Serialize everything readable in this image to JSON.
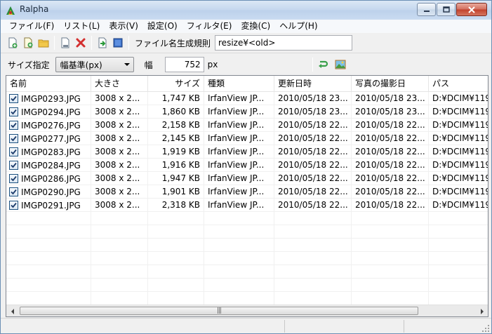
{
  "window": {
    "title": "Ralpha"
  },
  "menu": [
    "ファイル(F)",
    "リスト(L)",
    "表示(V)",
    "設定(O)",
    "フィルタ(E)",
    "変換(C)",
    "ヘルプ(H)"
  ],
  "toolbar": {
    "rule_label": "ファイル名生成規則",
    "rule_value": "resize¥<old>"
  },
  "size_bar": {
    "size_label": "サイズ指定",
    "mode_value": "幅基準(px)",
    "width_label": "幅",
    "width_value": "752",
    "unit_label": "px"
  },
  "list": {
    "columns": [
      "名前",
      "大きさ",
      "サイズ",
      "種類",
      "更新日時",
      "写真の撮影日",
      "パス"
    ],
    "rows": [
      {
        "name": "IMGP0293.JPG",
        "dims": "3008 x 2...",
        "size": "1,747 KB",
        "type": "IrfanView JP...",
        "modified": "2010/05/18 23...",
        "taken": "2010/05/18 23...",
        "path": "D:¥DCIM¥119"
      },
      {
        "name": "IMGP0294.JPG",
        "dims": "3008 x 2...",
        "size": "1,860 KB",
        "type": "IrfanView JP...",
        "modified": "2010/05/18 23...",
        "taken": "2010/05/18 23...",
        "path": "D:¥DCIM¥119"
      },
      {
        "name": "IMGP0276.JPG",
        "dims": "3008 x 2...",
        "size": "2,158 KB",
        "type": "IrfanView JP...",
        "modified": "2010/05/18 22...",
        "taken": "2010/05/18 22...",
        "path": "D:¥DCIM¥119"
      },
      {
        "name": "IMGP0277.JPG",
        "dims": "3008 x 2...",
        "size": "2,145 KB",
        "type": "IrfanView JP...",
        "modified": "2010/05/18 22...",
        "taken": "2010/05/18 22...",
        "path": "D:¥DCIM¥119"
      },
      {
        "name": "IMGP0283.JPG",
        "dims": "3008 x 2...",
        "size": "1,919 KB",
        "type": "IrfanView JP...",
        "modified": "2010/05/18 22...",
        "taken": "2010/05/18 22...",
        "path": "D:¥DCIM¥119"
      },
      {
        "name": "IMGP0284.JPG",
        "dims": "3008 x 2...",
        "size": "1,916 KB",
        "type": "IrfanView JP...",
        "modified": "2010/05/18 22...",
        "taken": "2010/05/18 22...",
        "path": "D:¥DCIM¥119"
      },
      {
        "name": "IMGP0286.JPG",
        "dims": "3008 x 2...",
        "size": "1,947 KB",
        "type": "IrfanView JP...",
        "modified": "2010/05/18 22...",
        "taken": "2010/05/18 22...",
        "path": "D:¥DCIM¥119"
      },
      {
        "name": "IMGP0290.JPG",
        "dims": "3008 x 2...",
        "size": "1,901 KB",
        "type": "IrfanView JP...",
        "modified": "2010/05/18 22...",
        "taken": "2010/05/18 22...",
        "path": "D:¥DCIM¥119"
      },
      {
        "name": "IMGP0291.JPG",
        "dims": "3008 x 2...",
        "size": "2,318 KB",
        "type": "IrfanView JP...",
        "modified": "2010/05/18 22...",
        "taken": "2010/05/18 22...",
        "path": "D:¥DCIM¥119"
      }
    ]
  },
  "icons": {
    "new_list": "new-document-icon",
    "add_file": "add-file-icon",
    "add_folder": "folder-icon",
    "properties": "document-properties-icon",
    "remove": "delete-x-icon",
    "convert": "convert-icon",
    "select_all": "select-all-icon",
    "rotate": "rotate-arrow-icon",
    "preview": "image-preview-icon"
  },
  "colors": {
    "title_bar": "#c4d7ee",
    "close_button": "#c1412c",
    "remove_icon": "#d32f2f",
    "checkbox_border": "#1c5180"
  }
}
